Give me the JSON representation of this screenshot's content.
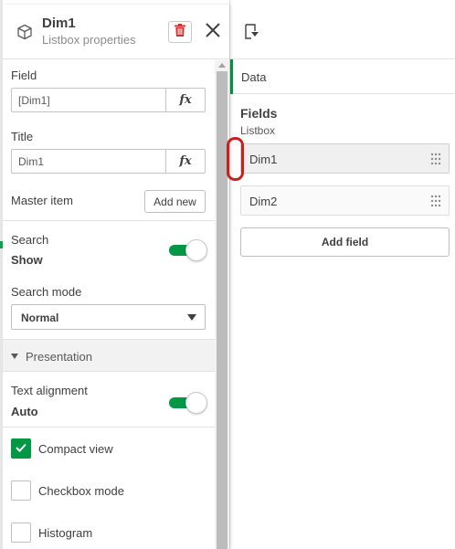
{
  "properties": {
    "title": "Dim1",
    "subtitle": "Listbox properties",
    "field": {
      "label": "Field",
      "value": "[Dim1]",
      "fx": "fx"
    },
    "title_field": {
      "label": "Title",
      "value": "Dim1",
      "fx": "fx"
    },
    "master_item": {
      "label": "Master item",
      "button": "Add new"
    },
    "search": {
      "label": "Search",
      "value": "Show",
      "toggle_on": true
    },
    "search_mode": {
      "label": "Search mode",
      "selected": "Normal"
    },
    "presentation": {
      "title": "Presentation"
    },
    "text_alignment": {
      "label": "Text alignment",
      "value": "Auto",
      "toggle_on": true
    },
    "options": [
      {
        "label": "Compact view",
        "checked": true
      },
      {
        "label": "Checkbox mode",
        "checked": false
      },
      {
        "label": "Histogram",
        "checked": false
      }
    ]
  },
  "data_panel": {
    "tab": "Data",
    "fields_title": "Fields",
    "fields_subtitle": "Listbox",
    "fields": [
      {
        "name": "Dim1",
        "selected": true
      },
      {
        "name": "Dim2",
        "selected": false
      }
    ],
    "add_field": "Add field"
  },
  "colors": {
    "accent_green": "#009845",
    "delete_red": "#d0312d",
    "highlight_red": "#cc1f1f"
  }
}
